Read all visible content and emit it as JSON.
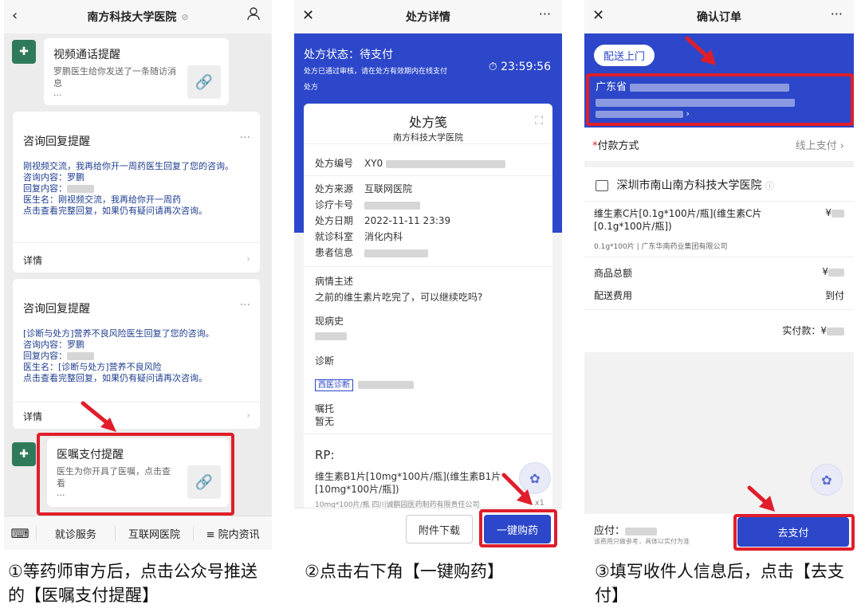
{
  "panel1": {
    "title": "南方科技大学医院",
    "muted_icon": "⊘",
    "msg1": {
      "title": "视频通话提醒",
      "desc": "罗鹏医生给你发送了一条随访消息",
      "more": "···"
    },
    "card1": {
      "title": "咨询回复提醒",
      "line1": "刚视频交流，我再给你开一周药医生回复了您的咨询。",
      "line2": "咨询内容：罗鹏",
      "line3": "回复内容：",
      "line4": "医生名：刚视频交流，我再给你开一周药",
      "line5": "点击查看完整回复，如果仍有疑问请再次咨询。",
      "detail": "详情"
    },
    "card2": {
      "title": "咨询回复提醒",
      "line1": "[诊断与处方]营养不良风险医生回复了您的咨询。",
      "line2": "咨询内容：罗鹏",
      "line3": "回复内容：",
      "line4": "医生名：[诊断与处方]营养不良风险",
      "line5": "点击查看完整回复，如果仍有疑问请再次咨询。",
      "detail": "详情"
    },
    "msg2": {
      "title": "医嘱支付提醒",
      "desc": "医生为你开具了医嘱，点击查看",
      "more": "···"
    },
    "bottom": [
      "就诊服务",
      "互联网医院",
      "≡ 院内资讯"
    ],
    "caption": "①等药师审方后，点击公众号推送的【医嘱支付提醒】"
  },
  "panel2": {
    "title": "处方详情",
    "status": "处方状态：待支付",
    "status_note": "处方已通过审核，请在处方有效期内在线支付",
    "status_note2": "处方",
    "timer": "23:59:56",
    "timer_icon": "⏱",
    "card_title": "处方笺",
    "card_hospital": "南方科技大学医院",
    "fields": [
      {
        "k": "处方编号",
        "v": "XY0"
      },
      {
        "k": "处方来源",
        "v": "互联网医院"
      },
      {
        "k": "诊疗卡号",
        "v": ""
      },
      {
        "k": "处方日期",
        "v": "2022-11-11 23:39"
      },
      {
        "k": "就诊科室",
        "v": "消化内科"
      },
      {
        "k": "患者信息",
        "v": ""
      }
    ],
    "complaint_label": "病情主述",
    "complaint": "之前的维生素片吃完了，可以继续吃吗?",
    "history_label": "现病史",
    "diag_label": "诊断",
    "diag_tag": "西医诊断",
    "advice_label": "嘱托",
    "advice": "暂无",
    "rp_label": "RP:",
    "drug": "维生素B1片[10mg*100片/瓶](维生素B1片[10mg*100片/瓶])",
    "drug_spec": "10mg*100片/瓶  四川诚鹏园医药制药有限责任公司",
    "qty": "x1",
    "btn_attach": "附件下载",
    "btn_buy": "一键购药",
    "caption": "②点击右下角【一键购药】"
  },
  "panel3": {
    "title": "确认订单",
    "delivery": "配送上门",
    "addr_prefix": "广东省",
    "pay_label": "付款方式",
    "pay_value": "线上支付",
    "hospital": "深圳市南山南方科技大学医院",
    "item": "维生素C片[0.1g*100片/瓶](维生素C片[0.1g*100片/瓶])",
    "item_spec": "0.1g*100片 | 广东华南药业集团有限公司",
    "price_sym": "¥",
    "goods_total_label": "商品总额",
    "ship_label": "配送费用",
    "ship_value": "到付",
    "paid_label": "实付款：",
    "due_label": "应付：",
    "due_note": "该费用只做参考，具体以实付为准",
    "btn_pay": "去支付",
    "caption": "③填写收件人信息后，点击【去支付】"
  },
  "colors": {
    "accent_blue": "#2c47c9",
    "highlight_red": "#e01e2b"
  }
}
